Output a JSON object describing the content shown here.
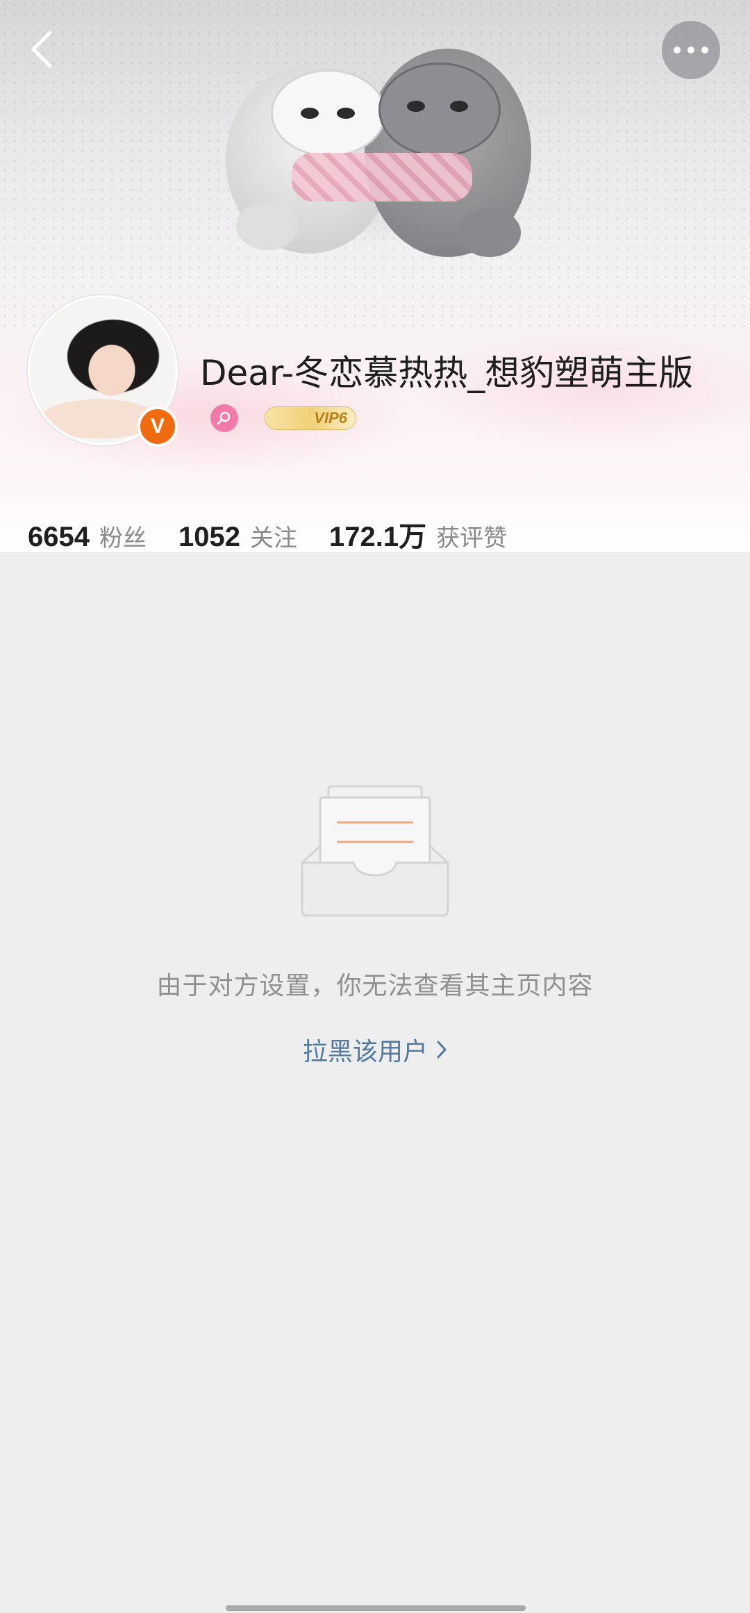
{
  "header": {
    "back_icon": "chevron-left-icon",
    "more_icon": "more-dots-icon"
  },
  "profile": {
    "username": "Dear-冬恋慕热热_想豹塑萌主版",
    "verified_badge": "V",
    "verified_color": "#f06a10",
    "gender_icon": "female-icon",
    "gender_color": "#f27aa8",
    "vip_label": "VIP6"
  },
  "stats": [
    {
      "value": "6654",
      "label": "粉丝"
    },
    {
      "value": "1052",
      "label": "关注"
    },
    {
      "value": "172.1万",
      "label": "获评赞"
    }
  ],
  "empty_state": {
    "icon": "empty-inbox-icon",
    "message": "由于对方设置，你无法查看其主页内容",
    "block_link": "拉黑该用户",
    "link_color": "#52799e"
  }
}
